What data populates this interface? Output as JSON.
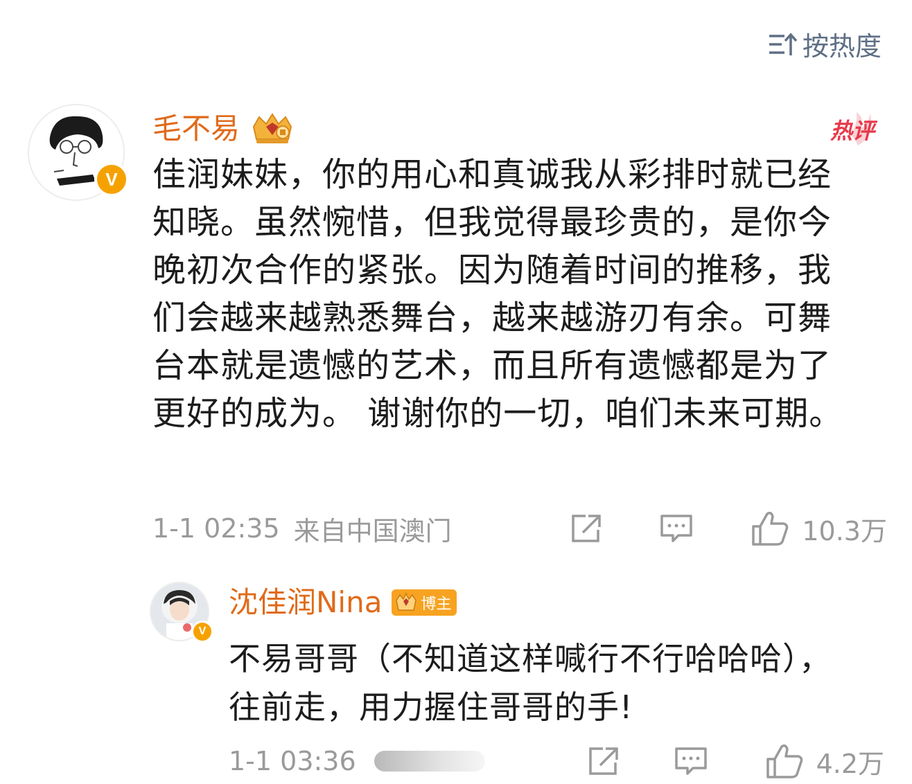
{
  "sort": {
    "label": "按热度",
    "icon": "sort-icon"
  },
  "comment": {
    "username": "毛不易",
    "username_color": "#e06a1a",
    "verified": "V",
    "hot_badge": "热评",
    "content": "佳润妹妹，你的用心和真诚我从彩排时就已经知晓。虽然惋惜，但我觉得最珍贵的，是你今晚初次合作的紧张。因为随着时间的推移，我们会越来越熟悉舞台，越来越游刃有余。可舞台本就是遗憾的艺术，而且所有遗憾都是为了更好的成为。 谢谢你的一切，咱们未来可期。",
    "time": "1-1 02:35",
    "location": "来自中国澳门",
    "likes": "10.3万"
  },
  "reply": {
    "username": "沈佳润Nina",
    "badge": "博主",
    "verified": "V",
    "content": "不易哥哥（不知道这样喊行不行哈哈哈），往前走，用力握住哥哥的手!",
    "time": "1-1 03:36",
    "likes": "4.2万"
  },
  "colors": {
    "meta_gray": "#9a9a9a",
    "sort_blue_gray": "#5f6f86",
    "verified_gold": "#f5a200",
    "hot_red": "#e8394b"
  }
}
